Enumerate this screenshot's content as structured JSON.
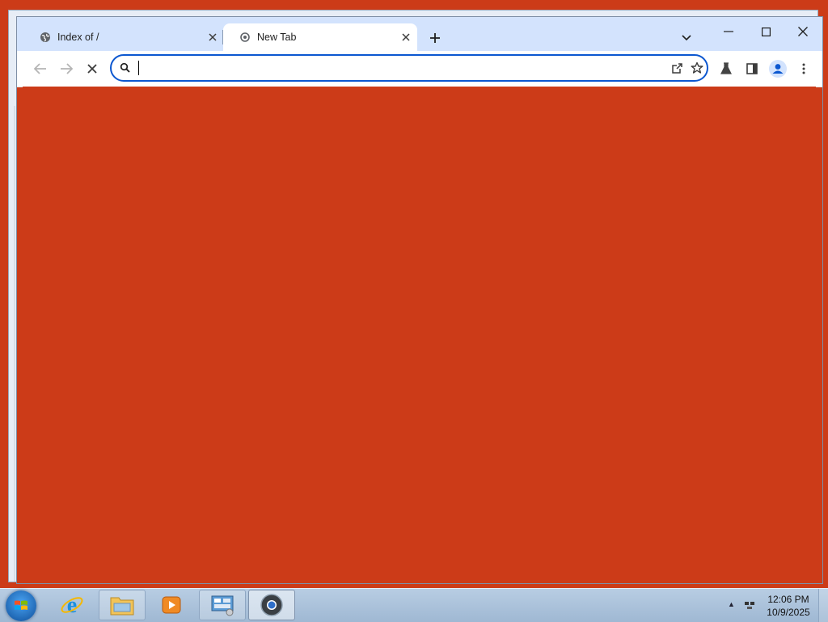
{
  "browser": {
    "tabs": [
      {
        "title": "Index of /",
        "active": false,
        "icon": "globe-icon"
      },
      {
        "title": "New Tab",
        "active": true,
        "icon": "loading-spinner-icon"
      }
    ],
    "omnibox": {
      "value": "",
      "placeholder": ""
    },
    "content_color": "#cc3b18",
    "accent_color": "#0b57d0"
  },
  "taskbar": {
    "apps": [
      "start-orb",
      "internet-explorer",
      "windows-explorer",
      "media-player",
      "control-panel",
      "chrome"
    ],
    "clock": {
      "time": "12:06 PM",
      "date": "10/9/2025"
    }
  }
}
